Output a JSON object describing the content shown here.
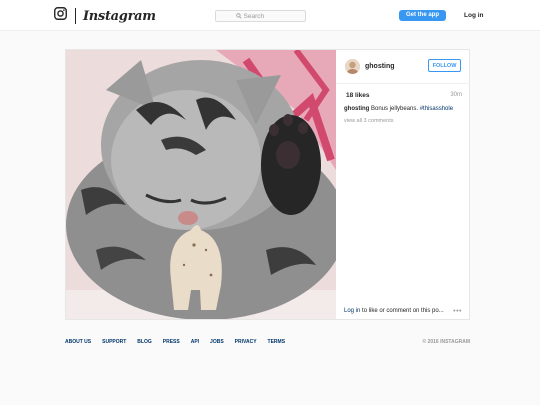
{
  "header": {
    "brand": "Instagram",
    "search_placeholder": "Search",
    "get_app_label": "Get the app",
    "login_label": "Log in"
  },
  "post": {
    "username": "ghosting",
    "follow_label": "FOLLOW",
    "likes": "18 likes",
    "time": "30m",
    "caption_user": "ghosting",
    "caption_text": " Bonus jellybeans. ",
    "caption_hashtag": "#thisasshole",
    "view_comments": "view all 3 comments",
    "comment_login_link": "Log in",
    "comment_prompt": " to like or comment on this po...",
    "more_label": "•••"
  },
  "footer": {
    "links": [
      "ABOUT US",
      "SUPPORT",
      "BLOG",
      "PRESS",
      "API",
      "JOBS",
      "PRIVACY",
      "TERMS"
    ],
    "copyright": "© 2016 INSTAGRAM"
  },
  "colors": {
    "accent": "#3897f0",
    "link": "#003569"
  }
}
